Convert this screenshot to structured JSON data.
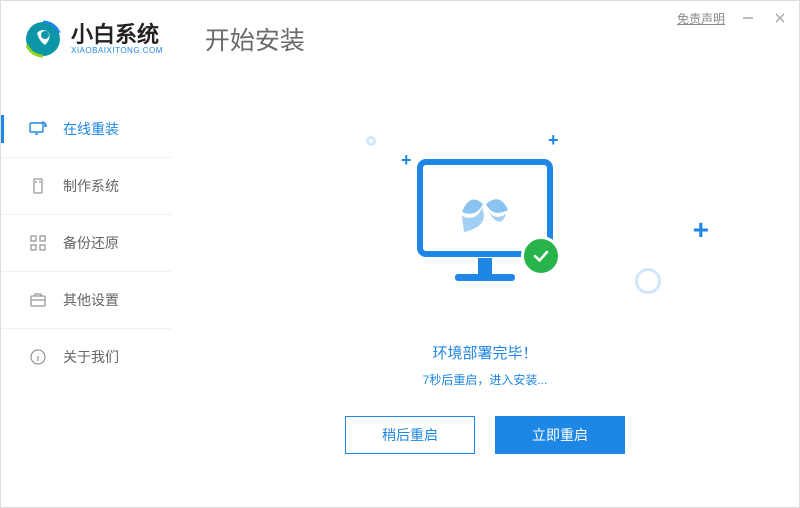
{
  "titlebar": {
    "disclaimer": "免责声明"
  },
  "brand": {
    "name": "小白系统",
    "sub": "XIAOBAIXITONG.COM",
    "title": "开始安装"
  },
  "sidebar": {
    "items": [
      {
        "label": "在线重装",
        "icon": "monitor-refresh-icon"
      },
      {
        "label": "制作系统",
        "icon": "usb-icon"
      },
      {
        "label": "备份还原",
        "icon": "grid-icon"
      },
      {
        "label": "其他设置",
        "icon": "briefcase-icon"
      },
      {
        "label": "关于我们",
        "icon": "info-icon"
      }
    ]
  },
  "main": {
    "status_title": "环境部署完毕！",
    "status_sub": "7秒后重启，进入安装...",
    "btn_later": "稍后重启",
    "btn_now": "立即重启"
  }
}
